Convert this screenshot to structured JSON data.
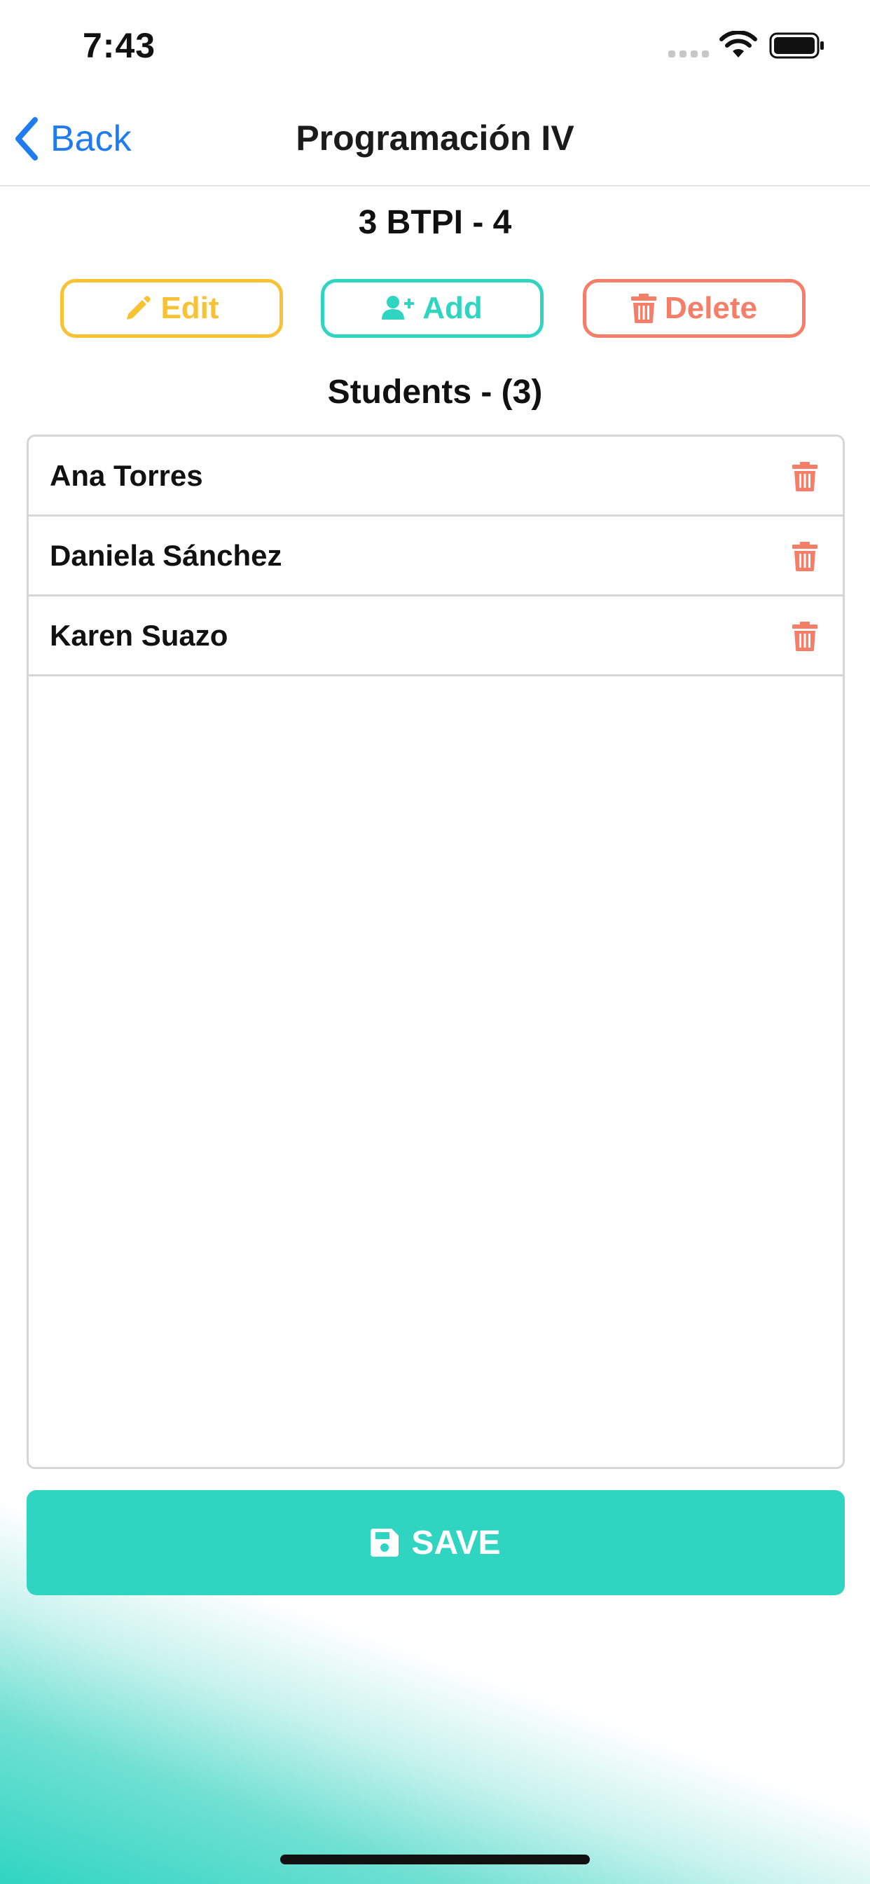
{
  "status_bar": {
    "time": "7:43"
  },
  "nav": {
    "back_label": "Back",
    "title": "Programación IV"
  },
  "group": {
    "title": "3 BTPI - 4"
  },
  "actions": {
    "edit_label": "Edit",
    "add_label": "Add",
    "delete_label": "Delete"
  },
  "students": {
    "title": "Students - (3)",
    "items": [
      {
        "name": "Ana Torres"
      },
      {
        "name": "Daniela Sánchez"
      },
      {
        "name": "Karen Suazo"
      }
    ]
  },
  "save": {
    "label": "SAVE"
  },
  "colors": {
    "accent_blue": "#1f7cf0",
    "edit_yellow": "#f8c234",
    "add_teal": "#30d5c2",
    "delete_coral": "#f47e67"
  },
  "icons": {
    "edit": "pencil-icon",
    "add": "user-plus-icon",
    "delete": "trash-icon",
    "save": "floppy-disk-icon",
    "back": "chevron-left-icon"
  }
}
